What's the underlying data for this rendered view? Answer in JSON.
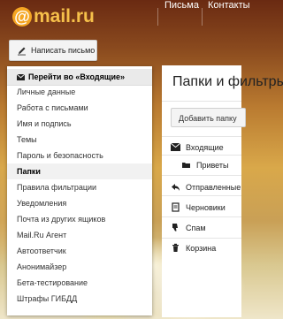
{
  "header": {
    "logo_at": "@",
    "logo_text": "mail.ru",
    "nav": [
      "Письма",
      "Контакты"
    ]
  },
  "compose": {
    "label": "Написать письмо"
  },
  "menu": {
    "items": [
      "Перейти во «Входящие»",
      "Личные данные",
      "Работа с письмами",
      "Имя и подпись",
      "Темы",
      "Пароль и безопасность",
      "Папки",
      "Правила фильтрации",
      "Уведомления",
      "Почта из других ящиков",
      "Mail.Ru Агент",
      "Автоответчик",
      "Анонимайзер",
      "Бета-тестирование",
      "Штрафы ГИБДД"
    ],
    "active_index": 6
  },
  "panel": {
    "title": "Папки и фильтры",
    "add_folder": "Добавить папку",
    "folders": [
      {
        "label": "Входящие",
        "icon": "envelope-icon"
      },
      {
        "label": "Приветы",
        "icon": "folder-icon"
      },
      {
        "label": "Отправленные",
        "icon": "reply-icon"
      },
      {
        "label": "Черновики",
        "icon": "draft-icon"
      },
      {
        "label": "Спам",
        "icon": "thumb-down-icon"
      },
      {
        "label": "Корзина",
        "icon": "trash-icon"
      }
    ]
  },
  "colors": {
    "logo_yellow": "#f6c04a",
    "logo_at_bg": "#f5a623",
    "header_bg": "#6a2a12"
  }
}
